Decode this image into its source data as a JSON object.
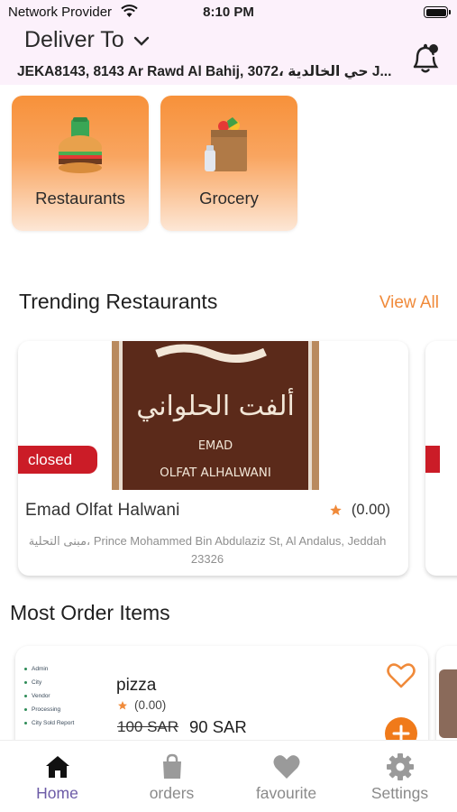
{
  "status_bar": {
    "carrier": "Network Provider",
    "time": "8:10 PM"
  },
  "header": {
    "deliver_to": "Deliver To",
    "address": "JEKA8143, 8143 Ar Rawd Al Bahij, 3072، حي الخالدية J..."
  },
  "categories": [
    {
      "label": "Restaurants",
      "icon": "burger-drink-icon"
    },
    {
      "label": "Grocery",
      "icon": "grocery-bag-icon"
    }
  ],
  "trending": {
    "title": "Trending Restaurants",
    "view_all": "View All",
    "restaurant": {
      "status": "closed",
      "name": "Emad Olfat Halwani",
      "rating": "(0.00)",
      "address": "مبنى التحلية، Prince Mohammed Bin Abdulaziz St, Al Andalus, Jeddah 23326",
      "logo_text_arabic": "ألفت الحلواني",
      "logo_text_line1": "EMAD",
      "logo_text_line2": "OLFAT ALHALWANI"
    }
  },
  "most_order": {
    "title": "Most Order Items",
    "item": {
      "name": "pizza",
      "rating": "(0.00)",
      "old_price": "100 SAR",
      "new_price": "90 SAR",
      "thumb_lines": [
        "Admin",
        "City",
        "Vendor",
        "Processing",
        "City Sold Report"
      ]
    }
  },
  "nav": [
    {
      "label": "Home",
      "icon": "home-icon",
      "active": true
    },
    {
      "label": "orders",
      "icon": "shopping-bag-icon",
      "active": false
    },
    {
      "label": "favourite",
      "icon": "heart-icon",
      "active": false
    },
    {
      "label": "Settings",
      "icon": "gear-icon",
      "active": false
    }
  ],
  "colors": {
    "accent": "#f08a3a",
    "closed": "#cb1c27",
    "nav_active": "#6b5aa6",
    "header_bg": "#fcf1fb"
  }
}
